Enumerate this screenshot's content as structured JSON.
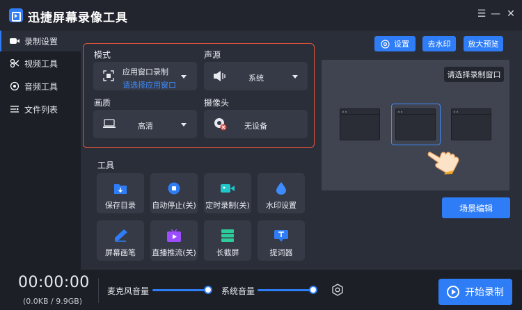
{
  "app": {
    "title": "迅捷屏幕录像工具"
  },
  "sidebar": {
    "items": [
      {
        "label": "录制设置",
        "icon": "camera-icon"
      },
      {
        "label": "视频工具",
        "icon": "video-tools-icon"
      },
      {
        "label": "音频工具",
        "icon": "audio-tools-icon"
      },
      {
        "label": "文件列表",
        "icon": "file-list-icon"
      }
    ]
  },
  "settings": {
    "mode": {
      "label": "模式",
      "value": "应用窗口录制",
      "link": "请选择应用窗口"
    },
    "audio": {
      "label": "声源",
      "value": "系统"
    },
    "quality": {
      "label": "画质",
      "value": "高清"
    },
    "camera": {
      "label": "摄像头",
      "value": "无设备"
    }
  },
  "tools": {
    "label": "工具",
    "items": [
      {
        "label": "保存目录",
        "icon": "folder-icon",
        "color": "#2f7df6"
      },
      {
        "label": "自动停止(关)",
        "icon": "stop-timer-icon",
        "color": "#2f7df6"
      },
      {
        "label": "定时录制(关)",
        "icon": "schedule-record-icon",
        "color": "#1fc7c8"
      },
      {
        "label": "水印设置",
        "icon": "watermark-icon",
        "color": "#3d8cff"
      },
      {
        "label": "屏幕画笔",
        "icon": "pen-icon",
        "color": "#2f7df6"
      },
      {
        "label": "直播推流(关)",
        "icon": "live-stream-icon",
        "color": "#9b4dff"
      },
      {
        "label": "长截屏",
        "icon": "long-screenshot-icon",
        "color": "#2ecc9a"
      },
      {
        "label": "提词器",
        "icon": "teleprompter-icon",
        "color": "#2f7df6"
      }
    ]
  },
  "right": {
    "settings_btn": "设置",
    "watermark_btn": "去水印",
    "zoom_btn": "放大预览",
    "preview_hint": "请选择录制窗口",
    "scene_btn": "场景编辑"
  },
  "bottom": {
    "timer": "00:00:00",
    "size": "(0.0KB / 9.9GB)",
    "mic_label": "麦克风音量",
    "mic_level": 1.0,
    "sys_label": "系统音量",
    "sys_level": 1.0,
    "start_label": "开始录制"
  },
  "colors": {
    "accent": "#2f7df6",
    "frame": "#e6543c"
  }
}
